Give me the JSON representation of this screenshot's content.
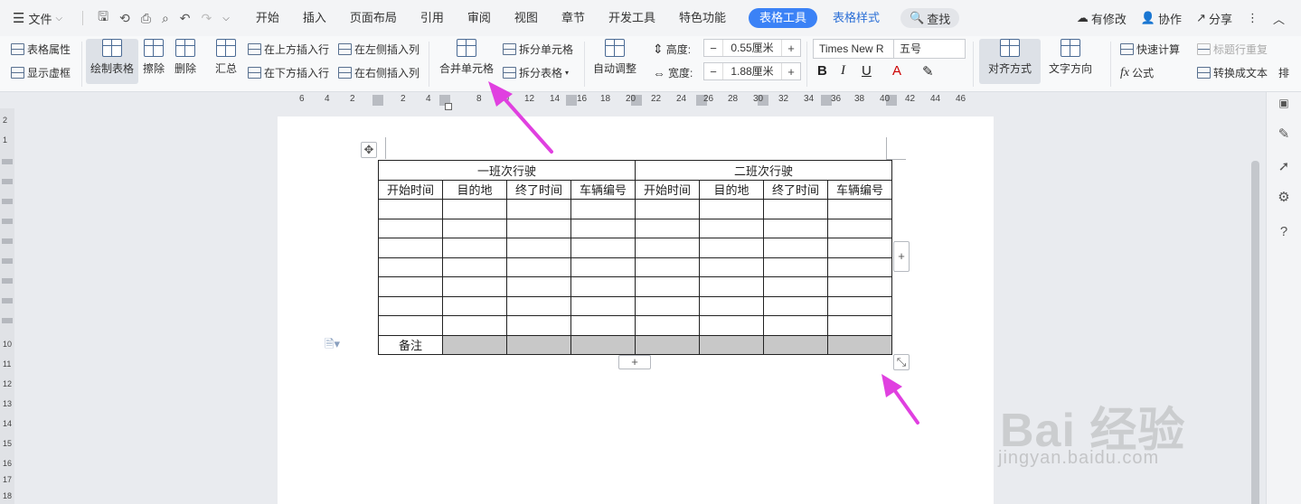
{
  "menubar": {
    "file_label": "文件",
    "tabs": [
      "开始",
      "插入",
      "页面布局",
      "引用",
      "审阅",
      "视图",
      "章节",
      "开发工具",
      "特色功能"
    ],
    "table_tools": "表格工具",
    "table_style": "表格样式",
    "search": "查找",
    "modified": "有修改",
    "collab": "协作",
    "share": "分享"
  },
  "ribbon": {
    "table_props": "表格属性",
    "show_grid": "显示虚框",
    "draw_table": "绘制表格",
    "erase": "擦除",
    "delete": "删除",
    "summary": "汇总",
    "insert_above": "在上方插入行",
    "insert_below": "在下方插入行",
    "insert_left": "在左侧插入列",
    "insert_right": "在右侧插入列",
    "merge_cells": "合并单元格",
    "split_cells": "拆分单元格",
    "split_table": "拆分表格",
    "auto_fit": "自动调整",
    "height_label": "高度:",
    "height_value": "0.55厘米",
    "width_label": "宽度:",
    "width_value": "1.88厘米",
    "font_name": "Times New R",
    "font_size": "五号",
    "align": "对齐方式",
    "text_dir": "文字方向",
    "quick_calc": "快速计算",
    "formula": "公式",
    "repeat_header": "标题行重复",
    "to_text": "转换成文本",
    "more": "排"
  },
  "ruler": {
    "labels": [
      "6",
      "4",
      "2",
      "2",
      "4",
      "8",
      "10",
      "12",
      "14",
      "16",
      "18",
      "20",
      "22",
      "24",
      "26",
      "28",
      "30",
      "32",
      "34",
      "36",
      "38",
      "40",
      "42",
      "44",
      "46"
    ]
  },
  "left_ruler": [
    "2",
    "1",
    "10",
    "11",
    "12",
    "13",
    "14",
    "15",
    "16",
    "17",
    "18"
  ],
  "table": {
    "group1": "一班次行驶",
    "group2": "二班次行驶",
    "headers": [
      "开始时间",
      "目的地",
      "终了时间",
      "车辆编号",
      "开始时间",
      "目的地",
      "终了时间",
      "车辆编号"
    ],
    "empty_rows": 7,
    "remark": "备注"
  },
  "watermark": {
    "brand": "Bai 经验",
    "url": "jingyan.baidu.com"
  },
  "colors": {
    "accent": "#3b82f6",
    "annotation_arrow": "#e040e0",
    "merged_cell": "#c8c8c8"
  }
}
